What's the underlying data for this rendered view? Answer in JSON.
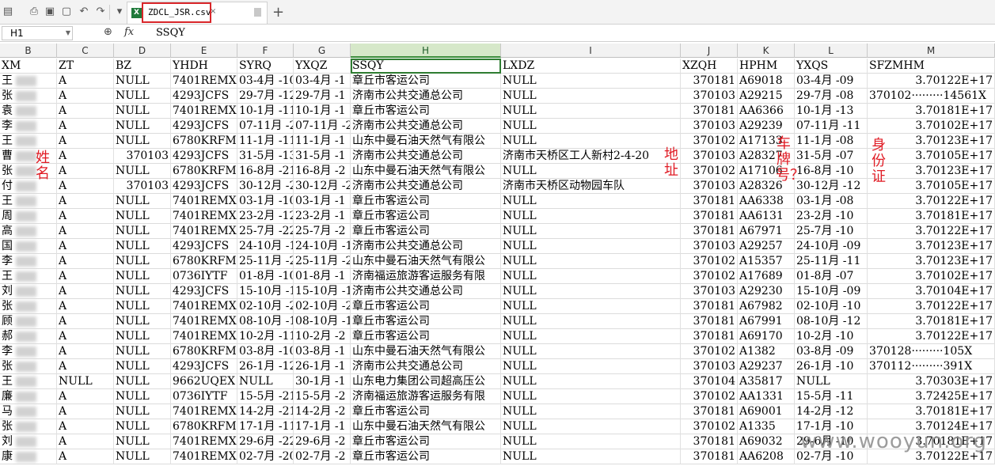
{
  "toolbar": {
    "file_tab_label": "ZDCL_JSR.csv",
    "file_tab_close": "×",
    "add_tab": "+",
    "excel_badge": "X"
  },
  "formula_bar": {
    "cell_ref": "H1",
    "fx_label": "fx",
    "value": "SSQY"
  },
  "columns": [
    "B",
    "C",
    "D",
    "E",
    "F",
    "G",
    "H",
    "I",
    "J",
    "K",
    "L",
    "M"
  ],
  "active_column": "H",
  "header_row": [
    "XM",
    "ZT",
    "BZ",
    "YHDH",
    "SYRQ",
    "YXQZ",
    "SSQY",
    "LXDZ",
    "",
    "XZQH",
    "HPHM",
    "YXQS",
    "SFZMHM"
  ],
  "rows": [
    [
      "王",
      "A",
      "NULL",
      "7401REMX",
      "03-4月 -10",
      "03-4月 -1",
      "章丘市客运公司",
      "NULL",
      "370181",
      "A69018",
      "03-4月 -09",
      "3.70122E+17"
    ],
    [
      "张",
      "A",
      "NULL",
      "4293JCFS",
      "29-7月 -12",
      "29-7月 -1",
      "济南市公共交通总公司",
      "NULL",
      "370103",
      "A29215",
      "29-7月 -08",
      "370102·········14561X"
    ],
    [
      "袁",
      "A",
      "NULL",
      "7401REMX",
      "10-1月 -11",
      "10-1月 -1",
      "章丘市客运公司",
      "NULL",
      "370181",
      "AA6366",
      "10-1月 -13",
      "3.70181E+17"
    ],
    [
      "李",
      "A",
      "NULL",
      "4293JCFS",
      "07-11月 -20",
      "07-11月 -2",
      "济南市公共交通总公司",
      "NULL",
      "370103",
      "A29239",
      "07-11月 -11",
      "3.70102E+17"
    ],
    [
      "王",
      "A",
      "NULL",
      "6780KRFM",
      "11-1月 -11",
      "11-1月 -1",
      "山东中曼石油天然气有限公",
      "NULL",
      "370102",
      "A17133",
      "11-1月 -08",
      "3.70123E+17"
    ],
    [
      "曹",
      "A",
      "370103",
      "4293JCFS",
      "31-5月 -13",
      "31-5月 -1",
      "济南市公共交通总公司",
      "济南市天桥区工人新村2-4-20",
      "370103",
      "A28327",
      "31-5月 -07",
      "3.70105E+17"
    ],
    [
      "张",
      "A",
      "NULL",
      "6780KRFM",
      "16-8月 -21",
      "16-8月 -2",
      "山东中曼石油天然气有限公",
      "NULL",
      "370102",
      "A17106",
      "16-8月 -10",
      "3.70123E+17"
    ],
    [
      "付",
      "A",
      "370103",
      "4293JCFS",
      "30-12月 -23",
      "30-12月 -2",
      "济南市公共交通总公司",
      "济南市天桥区动物园车队",
      "370103",
      "A28326",
      "30-12月 -12",
      "3.70105E+17"
    ],
    [
      "王",
      "A",
      "NULL",
      "7401REMX",
      "03-1月 -10",
      "03-1月 -1",
      "章丘市客运公司",
      "NULL",
      "370181",
      "AA6338",
      "03-1月 -08",
      "3.70122E+17"
    ],
    [
      "周",
      "A",
      "NULL",
      "7401REMX",
      "23-2月 -12",
      "23-2月 -1",
      "章丘市客运公司",
      "NULL",
      "370181",
      "AA6131",
      "23-2月 -10",
      "3.70181E+17"
    ],
    [
      "高",
      "A",
      "NULL",
      "7401REMX",
      "25-7月 -22",
      "25-7月 -2",
      "章丘市客运公司",
      "NULL",
      "370181",
      "A67971",
      "25-7月 -10",
      "3.70122E+17"
    ],
    [
      "国",
      "A",
      "NULL",
      "4293JCFS",
      "24-10月 -12",
      "24-10月 -1",
      "济南市公共交通总公司",
      "NULL",
      "370103",
      "A29257",
      "24-10月 -09",
      "3.70123E+17"
    ],
    [
      "李",
      "A",
      "NULL",
      "6780KRFM",
      "25-11月 -22",
      "25-11月 -2",
      "山东中曼石油天然气有限公",
      "NULL",
      "370102",
      "A15357",
      "25-11月 -11",
      "3.70123E+17"
    ],
    [
      "王",
      "A",
      "NULL",
      "0736IYTF",
      "01-8月 -10",
      "01-8月 -1",
      "济南福运旅游客运服务有限",
      "NULL",
      "370102",
      "A17689",
      "01-8月 -07",
      "3.70102E+17"
    ],
    [
      "刘",
      "A",
      "NULL",
      "4293JCFS",
      "15-10月 -11",
      "15-10月 -1",
      "济南市公共交通总公司",
      "NULL",
      "370103",
      "A29230",
      "15-10月 -09",
      "3.70104E+17"
    ],
    [
      "张",
      "A",
      "NULL",
      "7401REMX",
      "02-10月 -20",
      "02-10月 -2",
      "章丘市客运公司",
      "NULL",
      "370181",
      "A67982",
      "02-10月 -10",
      "3.70122E+17"
    ],
    [
      "顾",
      "A",
      "NULL",
      "7401REMX",
      "08-10月 -10",
      "08-10月 -1",
      "章丘市客运公司",
      "NULL",
      "370181",
      "A67991",
      "08-10月 -12",
      "3.70181E+17"
    ],
    [
      "郝",
      "A",
      "NULL",
      "7401REMX",
      "10-2月 -11",
      "10-2月 -2",
      "章丘市客运公司",
      "NULL",
      "370181",
      "A69170",
      "10-2月 -10",
      "3.70122E+17"
    ],
    [
      "李",
      "A",
      "NULL",
      "6780KRFM",
      "03-8月 -10",
      "03-8月 -1",
      "山东中曼石油天然气有限公",
      "NULL",
      "370102",
      "A1382",
      "03-8月 -09",
      "370128·········105X"
    ],
    [
      "张",
      "A",
      "NULL",
      "4293JCFS",
      "26-1月 -12",
      "26-1月 -1",
      "济南市公共交通总公司",
      "NULL",
      "370103",
      "A29237",
      "26-1月 -10",
      "370112·········391X"
    ],
    [
      "王",
      "NULL",
      "NULL",
      "9662UQEX",
      "NULL",
      "30-1月 -1",
      "山东电力集团公司超高压公",
      "NULL",
      "370104",
      "A35817",
      "NULL",
      "3.70303E+17"
    ],
    [
      "廉",
      "A",
      "NULL",
      "0736IYTF",
      "15-5月 -21",
      "15-5月 -2",
      "济南福运旅游客运服务有限",
      "NULL",
      "370102",
      "AA1331",
      "15-5月 -11",
      "3.72425E+17"
    ],
    [
      "马",
      "A",
      "NULL",
      "7401REMX",
      "14-2月 -21",
      "14-2月 -2",
      "章丘市客运公司",
      "NULL",
      "370181",
      "A69001",
      "14-2月 -12",
      "3.70181E+17"
    ],
    [
      "张",
      "A",
      "NULL",
      "6780KRFM",
      "17-1月 -11",
      "17-1月 -1",
      "山东中曼石油天然气有限公",
      "NULL",
      "370102",
      "A1335",
      "17-1月 -10",
      "3.70124E+17"
    ],
    [
      "刘",
      "A",
      "NULL",
      "7401REMX",
      "29-6月 -22",
      "29-6月 -2",
      "章丘市客运公司",
      "NULL",
      "370181",
      "A69032",
      "29-6月 -10",
      "3.70181E+17"
    ],
    [
      "康",
      "A",
      "NULL",
      "7401REMX",
      "02-7月 -20",
      "02-7月 -2",
      "章丘市客运公司",
      "NULL",
      "370181",
      "AA6208",
      "02-7月 -10",
      "3.70122E+17"
    ]
  ],
  "annotations": {
    "name": "姓名",
    "address": "地址",
    "plate": "车牌号？",
    "idcard": "身份证"
  },
  "watermark": "www.wooyun.org"
}
